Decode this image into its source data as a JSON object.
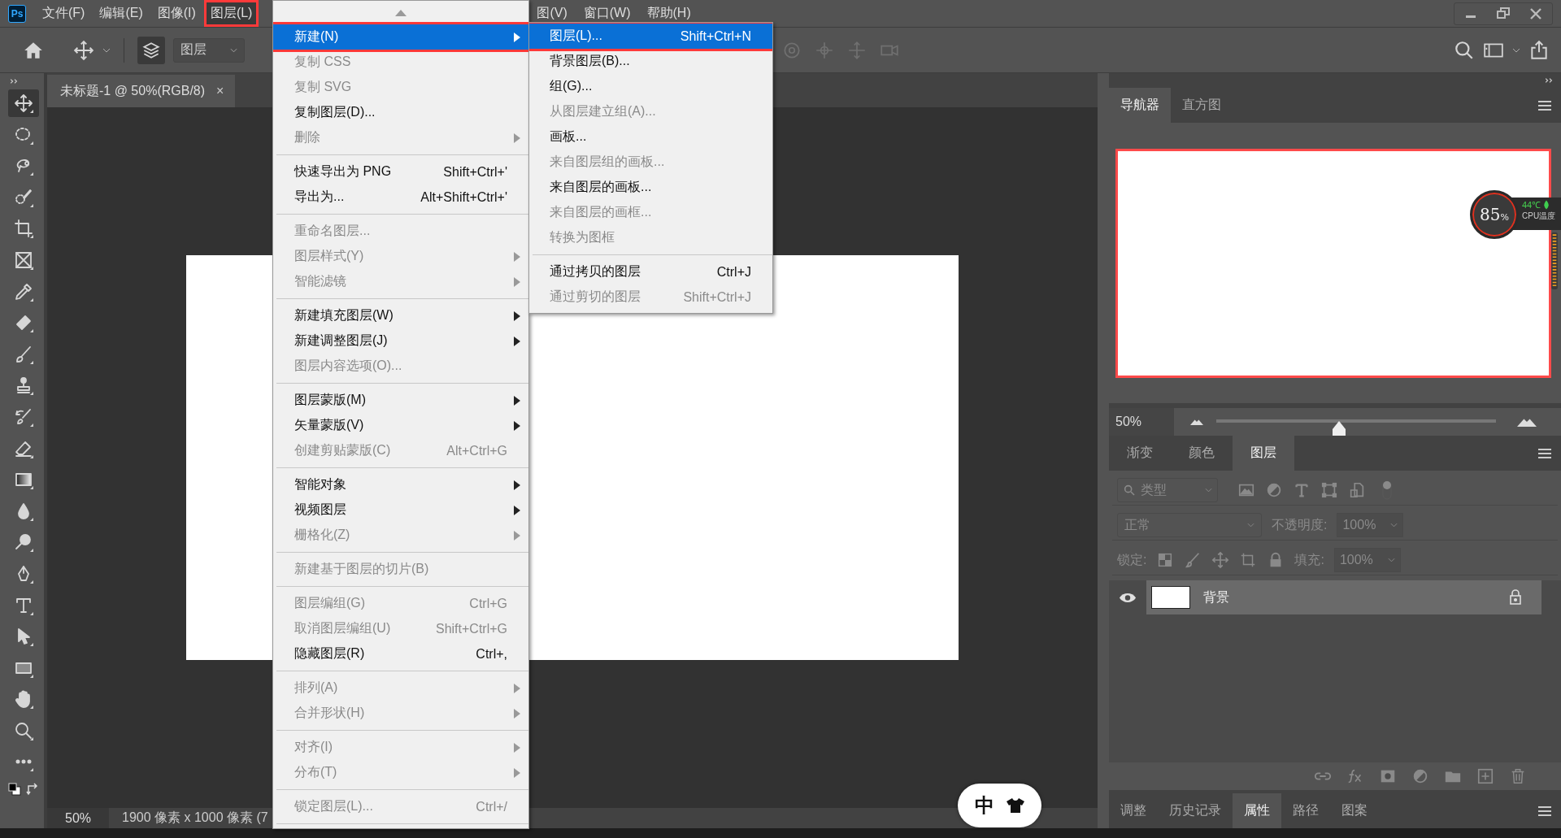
{
  "app": {
    "logo": "Ps"
  },
  "menubar": {
    "items": [
      {
        "label": "文件(F)",
        "selected": false
      },
      {
        "label": "编辑(E)",
        "selected": false
      },
      {
        "label": "图像(I)",
        "selected": false
      },
      {
        "label": "图层(L)",
        "selected": true
      }
    ],
    "items_right": [
      {
        "label": "图(V)",
        "selected": false
      },
      {
        "label": "窗口(W)",
        "selected": false
      },
      {
        "label": "帮助(H)",
        "selected": false
      }
    ]
  },
  "options_bar": {
    "target": "图层"
  },
  "document_tab": {
    "title": "未标题-1 @ 50%(RGB/8)",
    "close": "×"
  },
  "toolbar": {
    "tools": [
      {
        "selected": true
      },
      {
        "selected": false
      },
      {
        "selected": false
      },
      {
        "selected": false
      },
      {
        "selected": false
      },
      {
        "selected": false
      },
      {
        "selected": false
      },
      {
        "selected": false
      },
      {
        "selected": false
      },
      {
        "selected": false
      },
      {
        "selected": false
      },
      {
        "selected": false
      },
      {
        "selected": false
      },
      {
        "selected": false
      },
      {
        "selected": false
      },
      {
        "selected": false
      },
      {
        "selected": false
      },
      {
        "selected": false
      },
      {
        "selected": false
      },
      {
        "selected": false
      },
      {
        "selected": false
      },
      {
        "selected": false
      }
    ]
  },
  "status_bar": {
    "zoom": "50%",
    "doc_info": "1900 像素 x 1000 像素 (7"
  },
  "layer_menu": {
    "items": [
      {
        "kind": "item",
        "label": "新建(N)",
        "submenu": true,
        "disabled": false,
        "selected": true
      },
      {
        "kind": "item",
        "label": "复制 CSS",
        "submenu": false,
        "disabled": true,
        "selected": false
      },
      {
        "kind": "item",
        "label": "复制 SVG",
        "submenu": false,
        "disabled": true,
        "selected": false
      },
      {
        "kind": "item",
        "label": "复制图层(D)...",
        "submenu": false,
        "disabled": false,
        "selected": false
      },
      {
        "kind": "item",
        "label": "删除",
        "submenu": true,
        "disabled": true,
        "selected": false
      },
      {
        "kind": "separator"
      },
      {
        "kind": "item",
        "label": "快速导出为 PNG",
        "shortcut": "Shift+Ctrl+'",
        "submenu": false,
        "disabled": false,
        "selected": false
      },
      {
        "kind": "item",
        "label": "导出为...",
        "shortcut": "Alt+Shift+Ctrl+'",
        "submenu": false,
        "disabled": false,
        "selected": false
      },
      {
        "kind": "separator"
      },
      {
        "kind": "item",
        "label": "重命名图层...",
        "submenu": false,
        "disabled": true,
        "selected": false
      },
      {
        "kind": "item",
        "label": "图层样式(Y)",
        "submenu": true,
        "disabled": true,
        "selected": false
      },
      {
        "kind": "item",
        "label": "智能滤镜",
        "submenu": true,
        "disabled": true,
        "selected": false
      },
      {
        "kind": "separator"
      },
      {
        "kind": "item",
        "label": "新建填充图层(W)",
        "submenu": true,
        "disabled": false,
        "selected": false
      },
      {
        "kind": "item",
        "label": "新建调整图层(J)",
        "submenu": true,
        "disabled": false,
        "selected": false
      },
      {
        "kind": "item",
        "label": "图层内容选项(O)...",
        "submenu": false,
        "disabled": true,
        "selected": false
      },
      {
        "kind": "separator"
      },
      {
        "kind": "item",
        "label": "图层蒙版(M)",
        "submenu": true,
        "disabled": false,
        "selected": false
      },
      {
        "kind": "item",
        "label": "矢量蒙版(V)",
        "submenu": true,
        "disabled": false,
        "selected": false
      },
      {
        "kind": "item",
        "label": "创建剪贴蒙版(C)",
        "shortcut": "Alt+Ctrl+G",
        "submenu": false,
        "disabled": true,
        "selected": false
      },
      {
        "kind": "separator"
      },
      {
        "kind": "item",
        "label": "智能对象",
        "submenu": true,
        "disabled": false,
        "selected": false
      },
      {
        "kind": "item",
        "label": "视频图层",
        "submenu": true,
        "disabled": false,
        "selected": false
      },
      {
        "kind": "item",
        "label": "栅格化(Z)",
        "submenu": true,
        "disabled": true,
        "selected": false
      },
      {
        "kind": "separator"
      },
      {
        "kind": "item",
        "label": "新建基于图层的切片(B)",
        "submenu": false,
        "disabled": true,
        "selected": false
      },
      {
        "kind": "separator"
      },
      {
        "kind": "item",
        "label": "图层编组(G)",
        "shortcut": "Ctrl+G",
        "submenu": false,
        "disabled": true,
        "selected": false
      },
      {
        "kind": "item",
        "label": "取消图层编组(U)",
        "shortcut": "Shift+Ctrl+G",
        "submenu": false,
        "disabled": true,
        "selected": false
      },
      {
        "kind": "item",
        "label": "隐藏图层(R)",
        "shortcut": "Ctrl+,",
        "submenu": false,
        "disabled": false,
        "selected": false
      },
      {
        "kind": "separator"
      },
      {
        "kind": "item",
        "label": "排列(A)",
        "submenu": true,
        "disabled": true,
        "selected": false
      },
      {
        "kind": "item",
        "label": "合并形状(H)",
        "submenu": true,
        "disabled": true,
        "selected": false
      },
      {
        "kind": "separator"
      },
      {
        "kind": "item",
        "label": "对齐(I)",
        "submenu": true,
        "disabled": true,
        "selected": false
      },
      {
        "kind": "item",
        "label": "分布(T)",
        "submenu": true,
        "disabled": true,
        "selected": false
      },
      {
        "kind": "separator"
      },
      {
        "kind": "item",
        "label": "锁定图层(L)...",
        "shortcut": "Ctrl+/",
        "submenu": false,
        "disabled": true,
        "selected": false
      },
      {
        "kind": "separator"
      }
    ]
  },
  "new_submenu": {
    "items": [
      {
        "kind": "item",
        "label": "图层(L)...",
        "shortcut": "Shift+Ctrl+N",
        "disabled": false,
        "selected": true
      },
      {
        "kind": "item",
        "label": "背景图层(B)...",
        "disabled": false,
        "selected": false
      },
      {
        "kind": "item",
        "label": "组(G)...",
        "disabled": false,
        "selected": false
      },
      {
        "kind": "item",
        "label": "从图层建立组(A)...",
        "disabled": true,
        "selected": false
      },
      {
        "kind": "item",
        "label": "画板...",
        "disabled": false,
        "selected": false
      },
      {
        "kind": "item",
        "label": "来自图层组的画板...",
        "disabled": true,
        "selected": false
      },
      {
        "kind": "item",
        "label": "来自图层的画板...",
        "disabled": false,
        "selected": false
      },
      {
        "kind": "item",
        "label": "来自图层的画框...",
        "disabled": true,
        "selected": false
      },
      {
        "kind": "item",
        "label": "转换为图框",
        "disabled": true,
        "selected": false
      },
      {
        "kind": "separator"
      },
      {
        "kind": "item",
        "label": "通过拷贝的图层",
        "shortcut": "Ctrl+J",
        "disabled": false,
        "selected": false
      },
      {
        "kind": "item",
        "label": "通过剪切的图层",
        "shortcut": "Shift+Ctrl+J",
        "disabled": true,
        "selected": false
      }
    ]
  },
  "navigator": {
    "tabs": [
      {
        "label": "导航器",
        "selected": true
      },
      {
        "label": "直方图",
        "selected": false
      }
    ],
    "zoom": "50%",
    "zoom_slider": {
      "level": 0.44
    }
  },
  "cpu_widget": {
    "usage_value": "85",
    "usage_unit": "%",
    "temperature": "44℃",
    "label": "CPU温度"
  },
  "layers_panel": {
    "tabs": [
      {
        "label": "渐变",
        "selected": false
      },
      {
        "label": "颜色",
        "selected": false
      },
      {
        "label": "图层",
        "selected": true
      }
    ],
    "controls_disabled": true,
    "filter": "类型",
    "blend_mode": "正常",
    "opacity_label": "不透明度:",
    "opacity": "100%",
    "lock_label": "锁定:",
    "fill_label": "填充:",
    "fill": "100%",
    "layers": [
      {
        "name": "背景",
        "visible": true,
        "locked": true,
        "selected": true
      }
    ]
  },
  "bottom_panel": {
    "tabs": [
      {
        "label": "调整",
        "selected": false
      },
      {
        "label": "历史记录",
        "selected": false
      },
      {
        "label": "属性",
        "selected": true
      },
      {
        "label": "路径",
        "selected": false
      },
      {
        "label": "图案",
        "selected": false
      }
    ]
  },
  "ime": {
    "mode": "中"
  }
}
